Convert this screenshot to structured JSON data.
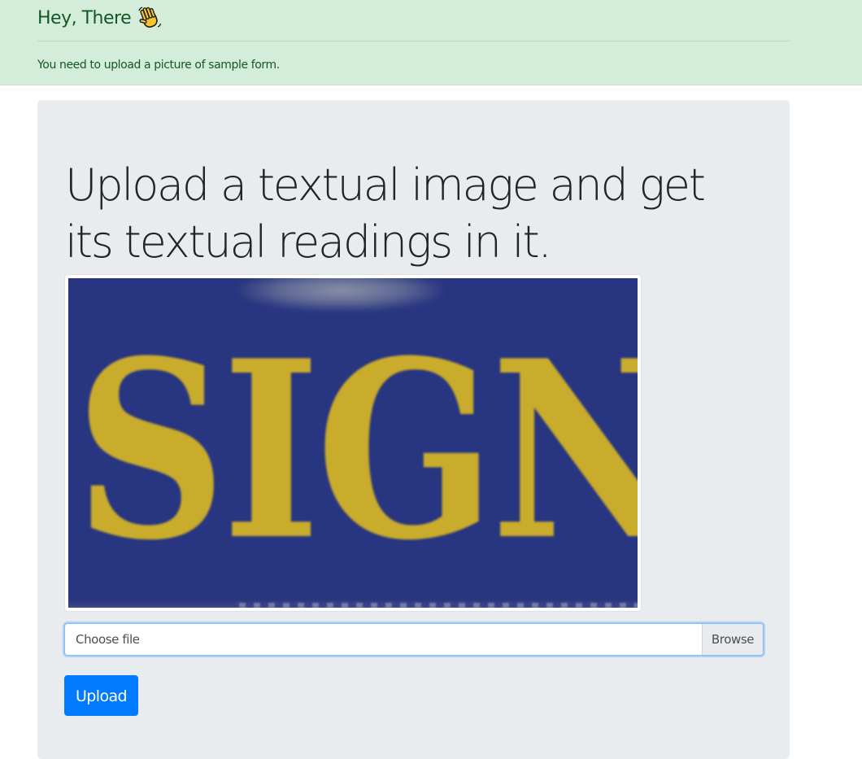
{
  "alert": {
    "heading": "Hey, There",
    "heading_icon": "waving-hand-icon",
    "message": "You need to upload a picture of sample form."
  },
  "main": {
    "title": "Upload a textual image and get its textual readings in it.",
    "preview": {
      "image_text": "SIGN",
      "image_colors": {
        "background": "#283580",
        "text": "#c9ac2c"
      }
    },
    "file_input": {
      "label": "Choose file",
      "browse_label": "Browse"
    },
    "upload_label": "Upload"
  },
  "colors": {
    "alert_bg": "#d4edda",
    "alert_text": "#155724",
    "jumbotron_bg": "#e9ecef",
    "primary": "#007bff"
  }
}
